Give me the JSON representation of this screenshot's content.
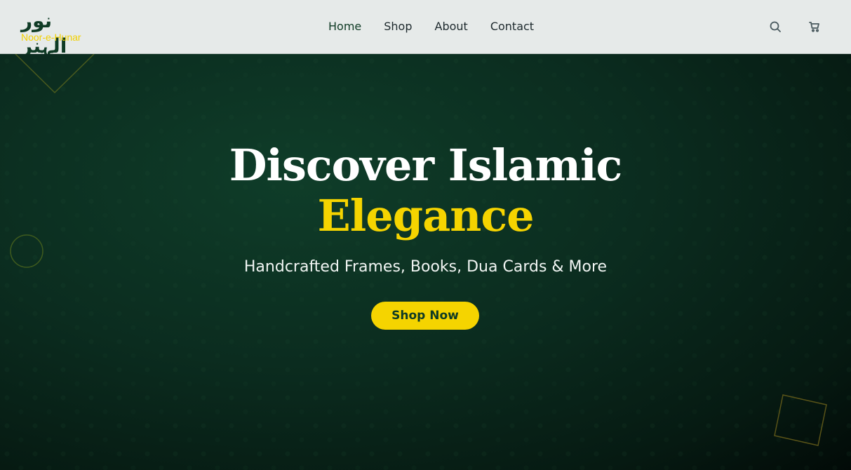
{
  "brand": {
    "name_arabic": "نور الہنر",
    "name_latin": "Noor-e-Hunar"
  },
  "nav": {
    "items": [
      "Home",
      "Shop",
      "About",
      "Contact"
    ],
    "active": "Home"
  },
  "header_icons": [
    "search-icon",
    "cart-icon"
  ],
  "hero": {
    "title_line1": "Discover Islamic",
    "title_line2": "Elegance",
    "subtitle": "Handcrafted Frames, Books, Dua Cards & More",
    "cta_label": "Shop Now"
  },
  "colors": {
    "primary_green": "#0f3b25",
    "accent_gold": "#f5d400",
    "header_bg": "#e6eae9"
  }
}
